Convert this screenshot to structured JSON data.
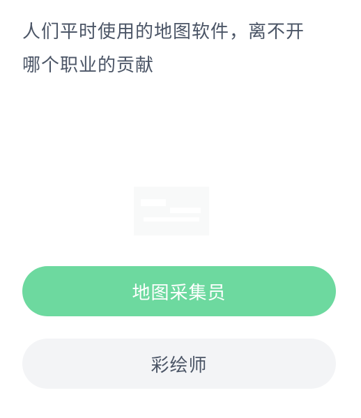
{
  "question": {
    "line1": "人们平时使用的地图软件，离不开",
    "line2": "哪个职业的贡献"
  },
  "options": [
    {
      "label": "地图采集员",
      "state": "selected"
    },
    {
      "label": "彩绘师",
      "state": "normal"
    }
  ],
  "illustration": {
    "icon": "faded-map-illustration-icon"
  },
  "colors": {
    "text": "#4b5566",
    "selected_bg": "#6dd99f",
    "selected_text": "#ffffff",
    "option_bg": "#f3f4f6"
  }
}
